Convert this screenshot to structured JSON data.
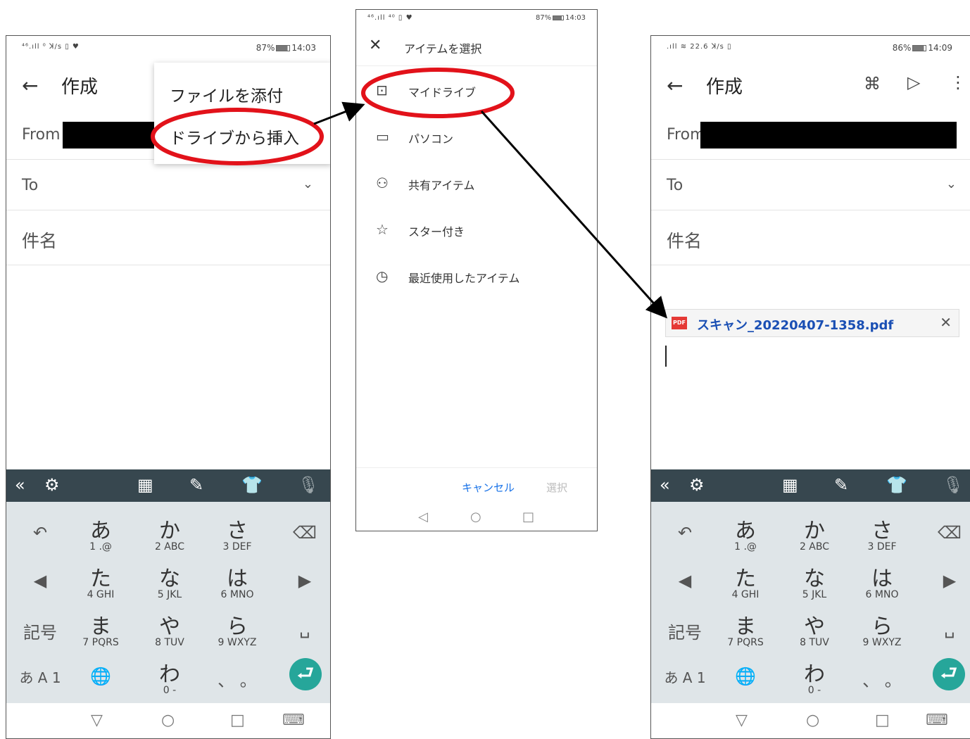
{
  "phone1": {
    "status_left": "⁴⁶.ıll ⁰ ꓘ/s ▯ ♥",
    "status_battery": "87%",
    "status_time": "14:03",
    "title": "作成",
    "from_label": "From",
    "to_label": "To",
    "subject_label": "件名",
    "menu": [
      "ファイルを添付",
      "ドライブから挿入"
    ]
  },
  "phone2": {
    "status_left": "⁴⁶.ıll ⁴⁰ ▯ ♥",
    "status_battery": "87%",
    "status_time": "14:03",
    "title": "アイテムを選択",
    "items": [
      "マイドライブ",
      "パソコン",
      "共有アイテム",
      "スター付き",
      "最近使用したアイテム"
    ],
    "cancel": "キャンセル",
    "select": "選択"
  },
  "phone3": {
    "status_left": ".ıll ≋ 22.6 ꓘ/s ▯",
    "status_battery": "86%",
    "status_time": "14:09",
    "title": "作成",
    "from_label": "From",
    "to_label": "To",
    "subject_label": "件名",
    "attachment": "スキャン_20220407-1358.pdf"
  },
  "keyboard": {
    "row1": [
      {
        "big": "あ",
        "sub": "1  .@"
      },
      {
        "big": "か",
        "sub": "2  ABC"
      },
      {
        "big": "さ",
        "sub": "3  DEF"
      }
    ],
    "row2": [
      {
        "big": "た",
        "sub": "4  GHI"
      },
      {
        "big": "な",
        "sub": "5  JKL"
      },
      {
        "big": "は",
        "sub": "6  MNO"
      }
    ],
    "row3": [
      {
        "big": "ま",
        "sub": "7 PQRS"
      },
      {
        "big": "や",
        "sub": "8  TUV"
      },
      {
        "big": "ら",
        "sub": "9 WXYZ"
      }
    ],
    "row4": [
      {
        "big": "わ",
        "sub": "0  -"
      },
      {
        "big": "、 。",
        "sub": ""
      }
    ],
    "kigo": "記号",
    "mode": "あ A 1"
  },
  "colors": {
    "highlight_red": "#e2121a",
    "enter_teal": "#26a69a",
    "kb_bar": "#37474f",
    "link_blue": "#1a4fb4"
  }
}
